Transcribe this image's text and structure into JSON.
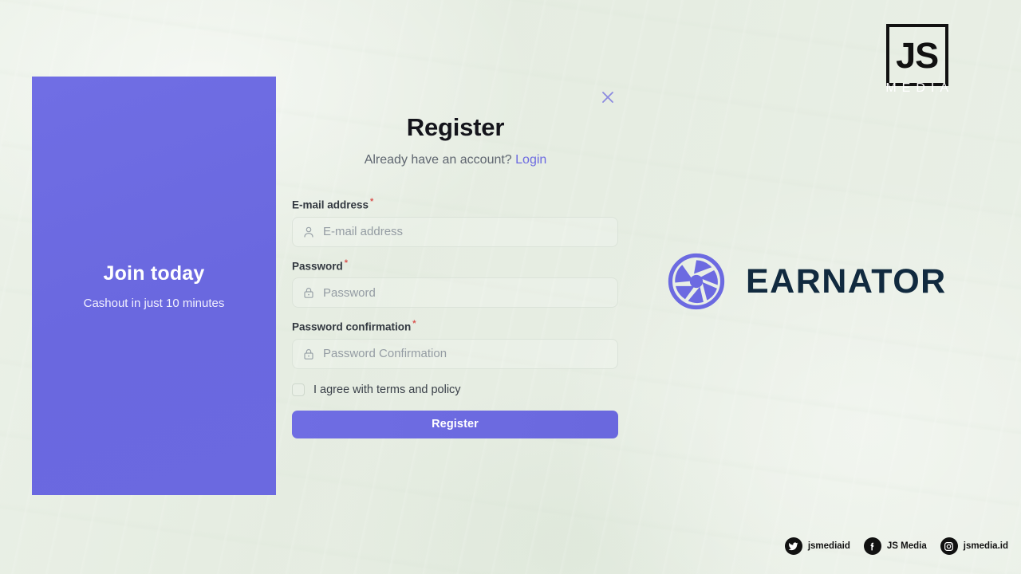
{
  "page": {
    "background_color": "#e7ede3",
    "accent_color": "#6c6ae1"
  },
  "promo_panel": {
    "title": "Join today",
    "subtitle": "Cashout in just 10 minutes",
    "background_color": "#6c6ae1"
  },
  "form": {
    "title": "Register",
    "subtitle_text": "Already have an account?",
    "login_link": "Login",
    "close_icon": "close-icon",
    "fields": [
      {
        "label": "E-mail address",
        "required_marker": "*",
        "placeholder": "E-mail address",
        "value": "",
        "icon": "person-icon"
      },
      {
        "label": "Password",
        "required_marker": "*",
        "placeholder": "Password",
        "value": "",
        "icon": "lock-icon"
      },
      {
        "label": "Password confirmation",
        "required_marker": "*",
        "placeholder": "Password Confirmation",
        "value": "",
        "icon": "lock-icon"
      }
    ],
    "agree_label": "I agree with terms and policy",
    "agree_checked": false,
    "submit_label": "Register"
  },
  "brand": {
    "name": "EARNATOR",
    "mark_icon": "aperture-icon",
    "mark_color": "#6c6ae1",
    "text_color": "#112a3f"
  },
  "jsmedia": {
    "monogram": "JS",
    "wordmark": "MEDIA"
  },
  "social": [
    {
      "icon": "twitter-icon",
      "handle": "jsmediaid"
    },
    {
      "icon": "facebook-icon",
      "handle": "JS Media"
    },
    {
      "icon": "instagram-icon",
      "handle": "jsmedia.id"
    }
  ]
}
